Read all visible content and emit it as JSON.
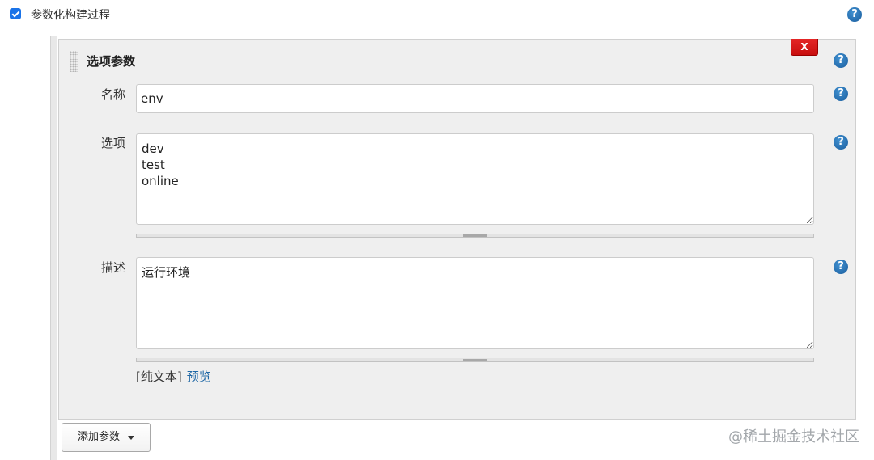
{
  "section": {
    "enabled": true,
    "title": "参数化构建过程"
  },
  "help_icon": {
    "glyph": "?",
    "icon": "help-icon"
  },
  "parameter": {
    "title": "选项参数",
    "delete_label": "X",
    "fields": {
      "name": {
        "label": "名称",
        "value": "env"
      },
      "choices": {
        "label": "选项",
        "value": "dev\ntest\nonline"
      },
      "description": {
        "label": "描述",
        "value": "运行环境"
      }
    },
    "description_format": {
      "plain_text": "[纯文本]",
      "preview_link": "预览"
    }
  },
  "add_parameter": {
    "label": "添加参数",
    "icon": "caret-down-icon"
  },
  "watermark": "@稀土掘金技术社区",
  "icons": {
    "checkbox": "checkbox-checked-icon",
    "help": "help-icon",
    "delete": "delete-icon",
    "drag": "drag-handle-icon",
    "dropdown": "caret-down-icon"
  },
  "colors": {
    "accent": "#1a73e8",
    "help": "#1b5e9e",
    "link": "#1f68a6",
    "danger": "#c80f0f",
    "panel_bg": "#efefef"
  }
}
